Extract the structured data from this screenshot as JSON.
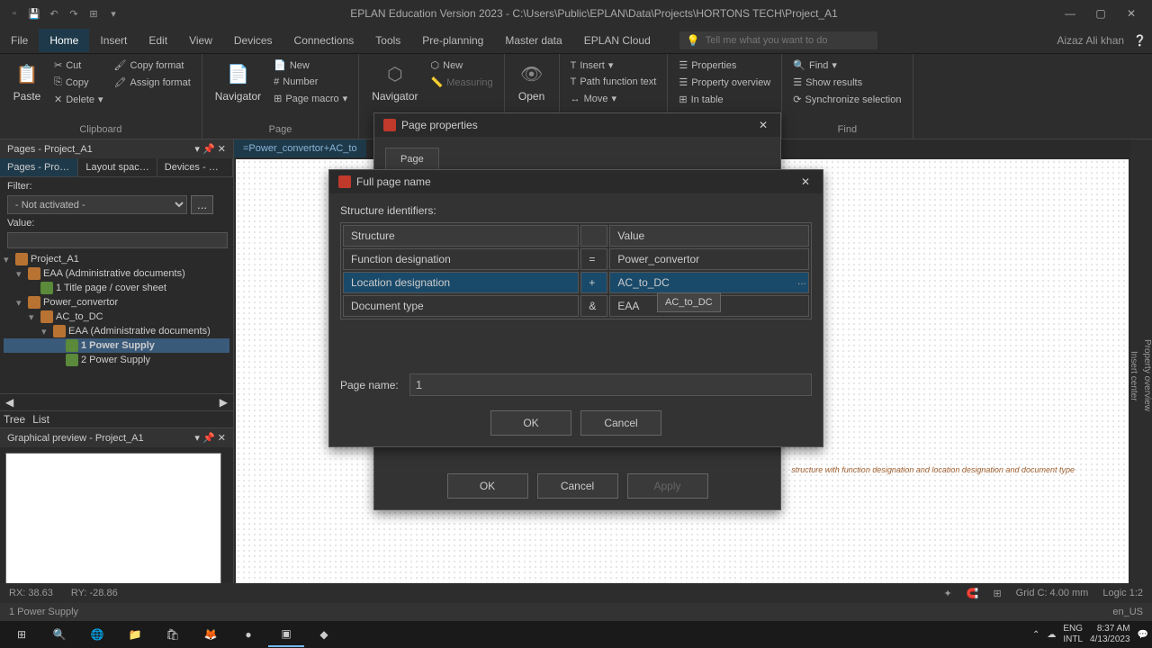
{
  "titlebar": {
    "title": "EPLAN Education Version 2023 - C:\\Users\\Public\\EPLAN\\Data\\Projects\\HORTONS TECH\\Project_A1"
  },
  "menu": {
    "items": [
      "File",
      "Home",
      "Insert",
      "Edit",
      "View",
      "Devices",
      "Connections",
      "Tools",
      "Pre-planning",
      "Master data",
      "EPLAN Cloud"
    ],
    "active_index": 1,
    "search_placeholder": "Tell me what you want to do",
    "user": "Aizaz Ali khan"
  },
  "ribbon": {
    "clipboard": {
      "label": "Clipboard",
      "paste": "Paste",
      "cut": "Cut",
      "copy": "Copy",
      "delete": "Delete",
      "copy_format": "Copy format",
      "assign_format": "Assign format"
    },
    "page": {
      "label": "Page",
      "navigator": "Navigator",
      "new": "New",
      "number": "Number",
      "page_macro": "Page macro"
    },
    "d3": {
      "label": "",
      "navigator": "Navigator",
      "new": "New",
      "measuring": "Measuring"
    },
    "open": {
      "label": "Open"
    },
    "text": {
      "insert": "Insert",
      "path_function": "Path function text",
      "move": "Move"
    },
    "edit": {
      "properties": "Properties",
      "property_overview": "Property overview",
      "in_table": "In table"
    },
    "find": {
      "label": "Find",
      "find": "Find",
      "show_results": "Show results",
      "sync": "Synchronize selection"
    }
  },
  "left_panel": {
    "header": "Pages - Project_A1",
    "tabs": [
      "Pages - Projec...",
      "Layout space -...",
      "Devices - Proj..."
    ],
    "filter_label": "Filter:",
    "filter_value": "- Not activated -",
    "value_label": "Value:",
    "tree": {
      "root": "Project_A1",
      "n1": "EAA (Administrative documents)",
      "n1_1": "1 Title page / cover sheet",
      "n2": "Power_convertor",
      "n2_1": "AC_to_DC",
      "n2_1_1": "EAA (Administrative documents)",
      "n2_1_1_1": "1 Power Supply",
      "n2_1_1_2": "2 Power Supply"
    },
    "view_tree": "Tree",
    "view_list": "List",
    "preview_header": "Graphical preview - Project_A1"
  },
  "doc_tab": "=Power_convertor+AC_to",
  "page_props": {
    "title": "Page properties",
    "tab": "Page",
    "ok": "OK",
    "cancel": "Cancel",
    "apply": "Apply"
  },
  "full_page": {
    "title": "Full page name",
    "struct_label": "Structure identifiers:",
    "col_structure": "Structure",
    "col_value": "Value",
    "rows": [
      {
        "structure": "Function designation",
        "sep": "=",
        "value": "Power_convertor"
      },
      {
        "structure": "Location designation",
        "sep": "+",
        "value": "AC_to_DC"
      },
      {
        "structure": "Document type",
        "sep": "&",
        "value": "EAA"
      }
    ],
    "page_name_label": "Page name:",
    "page_name_value": "1",
    "ok": "OK",
    "cancel": "Cancel",
    "dropdown_item": "AC_to_DC"
  },
  "annotation": "structure with function designation and location designation and document type",
  "status": {
    "rx": "RX: 38.63",
    "ry": "RY: -28.86",
    "grid": "Grid C: 4.00 mm",
    "logic": "Logic 1:2",
    "selected": "1 Power Supply",
    "lang": "en_US"
  },
  "taskbar": {
    "lang_code": "ENG",
    "lang_region": "INTL",
    "time": "8:37 AM",
    "date": "4/13/2023"
  }
}
